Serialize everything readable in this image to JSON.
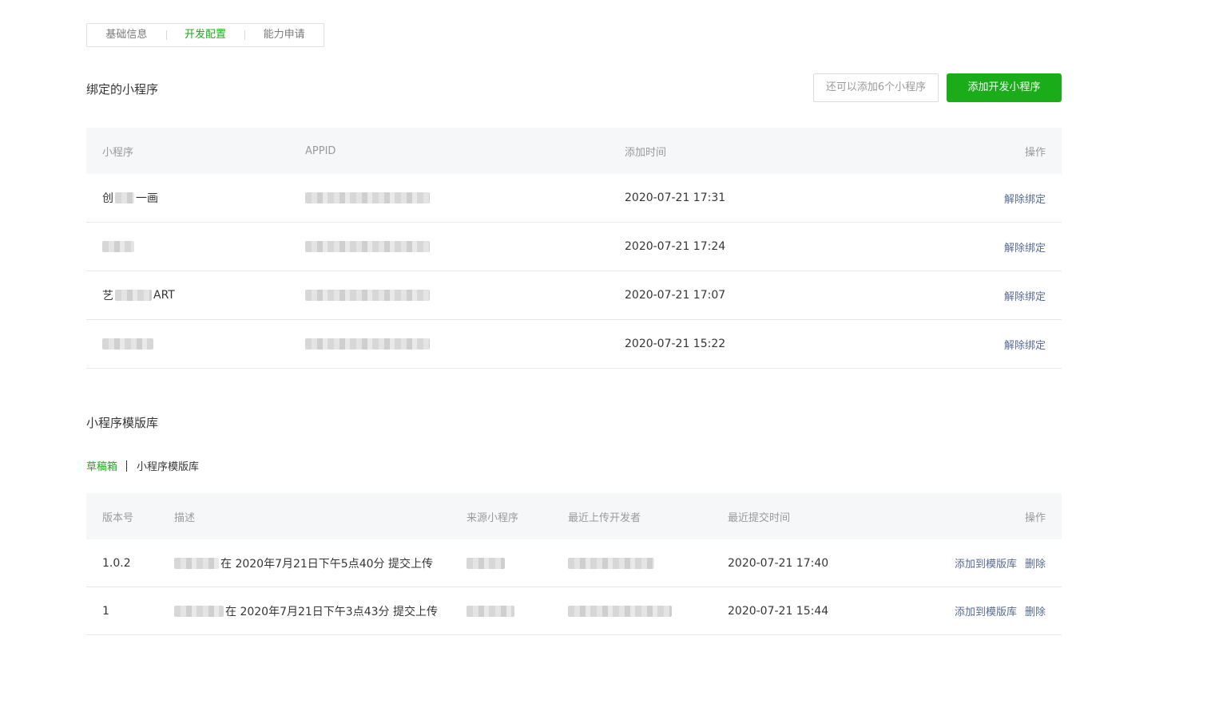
{
  "top_tabs": [
    {
      "label": "基础信息",
      "active": false
    },
    {
      "label": "开发配置",
      "active": true
    },
    {
      "label": "能力申请",
      "active": false
    }
  ],
  "bound": {
    "title": "绑定的小程序",
    "quota_text": "还可以添加6个小程序",
    "add_button": "添加开发小程序",
    "headers": [
      "小程序",
      "APPID",
      "添加时间",
      "操作"
    ],
    "rows": [
      {
        "name_prefix": "创",
        "name_suffix": "一画",
        "time": "2020-07-21 17:31",
        "action": "解除绑定"
      },
      {
        "name_prefix": "",
        "name_suffix": "",
        "time": "2020-07-21 17:24",
        "action": "解除绑定"
      },
      {
        "name_prefix": "艺",
        "name_suffix": "ART",
        "time": "2020-07-21 17:07",
        "action": "解除绑定"
      },
      {
        "name_prefix": "",
        "name_suffix": "",
        "time": "2020-07-21 15:22",
        "action": "解除绑定"
      }
    ]
  },
  "templates": {
    "title": "小程序模版库",
    "subtabs": [
      {
        "label": "草稿箱",
        "active": true
      },
      {
        "label": "小程序模版库",
        "active": false
      }
    ],
    "headers": [
      "版本号",
      "描述",
      "来源小程序",
      "最近上传开发者",
      "最近提交时间",
      "操作"
    ],
    "rows": [
      {
        "version": "1.0.2",
        "desc": "在 2020年7月21日下午5点40分 提交上传",
        "time": "2020-07-21 17:40",
        "add_action": "添加到模版库",
        "delete_action": "删除"
      },
      {
        "version": "1",
        "desc": "在 2020年7月21日下午3点43分 提交上传",
        "time": "2020-07-21 15:44",
        "add_action": "添加到模版库",
        "delete_action": "删除"
      }
    ]
  },
  "colors": {
    "accent": "#1aad19",
    "link": "#576b95"
  }
}
